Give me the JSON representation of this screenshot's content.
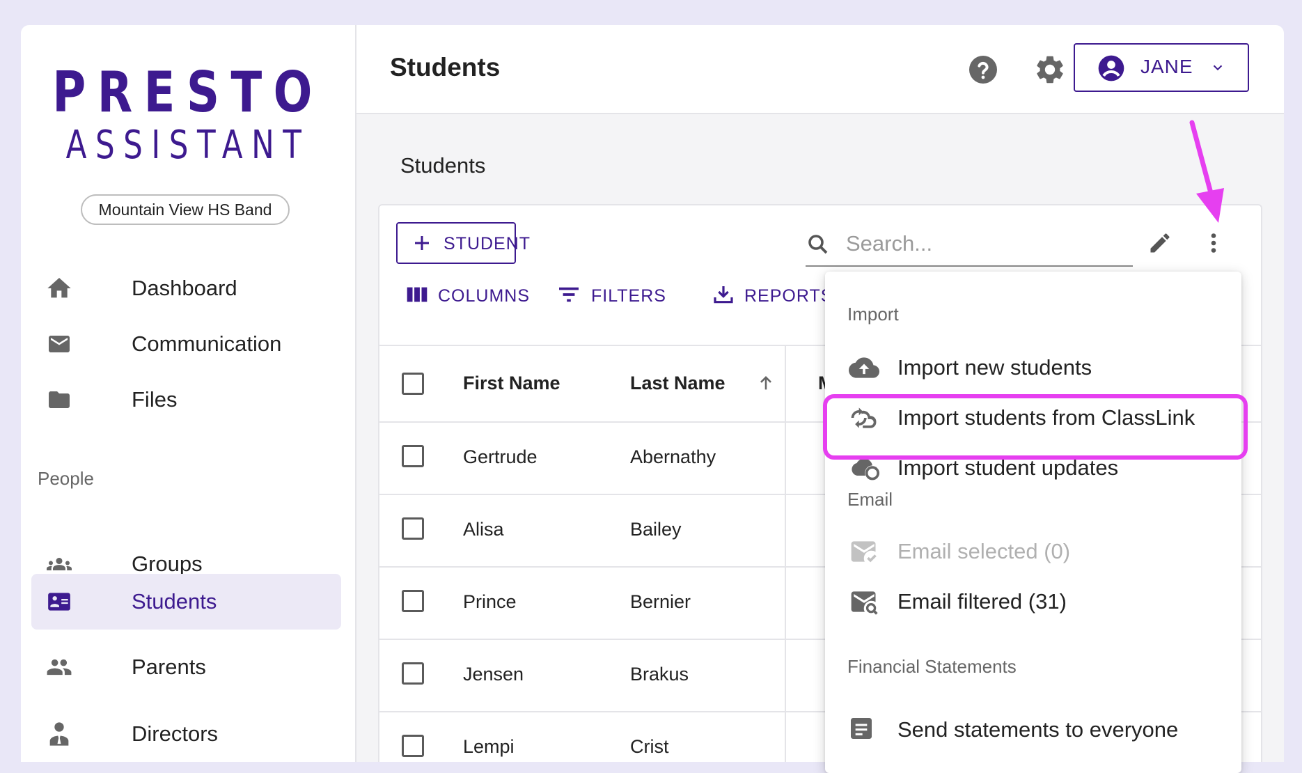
{
  "sidebar": {
    "logo_top": "PRESTO",
    "logo_bottom": "ASSISTANT",
    "org": "Mountain View HS Band",
    "items": [
      {
        "label": "Dashboard"
      },
      {
        "label": "Communication"
      },
      {
        "label": "Files"
      },
      {
        "label": "Groups"
      },
      {
        "label": "Students"
      },
      {
        "label": "Parents"
      },
      {
        "label": "Directors"
      }
    ],
    "section_people": "People"
  },
  "header": {
    "title": "Students",
    "user": "JANE"
  },
  "content": {
    "title": "Students",
    "add_button": "STUDENT",
    "search_placeholder": "Search...",
    "toolbar": {
      "columns": "COLUMNS",
      "filters": "FILTERS",
      "reports": "REPORTS"
    },
    "columns": [
      "First Name",
      "Last Name",
      "Mic"
    ],
    "rows": [
      {
        "first": "Gertrude",
        "last": "Abernathy"
      },
      {
        "first": "Alisa",
        "last": "Bailey"
      },
      {
        "first": "Prince",
        "last": "Bernier"
      },
      {
        "first": "Jensen",
        "last": "Brakus"
      },
      {
        "first": "Lempi",
        "last": "Crist"
      }
    ]
  },
  "menu": {
    "sections": {
      "import": "Import",
      "email": "Email",
      "financial": "Financial Statements"
    },
    "items": {
      "import_new": "Import new students",
      "import_classlink": "Import students from ClassLink",
      "import_updates": "Import student updates",
      "email_selected": "Email selected (0)",
      "email_filtered": "Email filtered (31)",
      "send_statements": "Send statements to everyone"
    }
  },
  "colors": {
    "brand": "#3d1a8f",
    "highlight": "#e63ff0",
    "background": "#e9e7f7"
  },
  "icons": {
    "help": "help-circle-icon",
    "settings": "gear-icon",
    "user": "account-circle-icon",
    "more": "more-vertical-icon"
  }
}
